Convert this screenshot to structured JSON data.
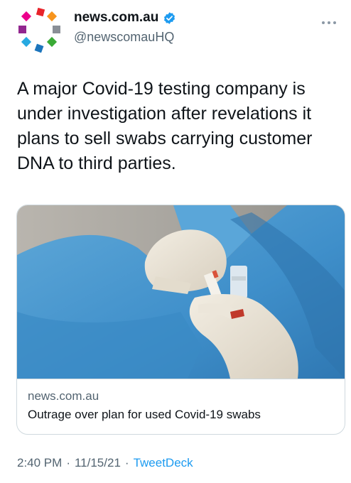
{
  "user": {
    "display_name": "news.com.au",
    "handle": "@newscomauHQ"
  },
  "more_icon": "more-icon",
  "tweet": {
    "text": "A major Covid-19 testing company is under investigation after revelations it plans to sell swabs carrying customer DNA to third parties."
  },
  "card": {
    "domain": "news.com.au",
    "title": "Outrage over plan for used Covid-19 swabs"
  },
  "meta": {
    "time": "2:40 PM",
    "sep1": "·",
    "date": "11/15/21",
    "sep2": "·",
    "source": "TweetDeck"
  },
  "colors": {
    "link": "#1d9bf0",
    "secondary_text": "#536471",
    "verified": "#1d9bf0"
  }
}
